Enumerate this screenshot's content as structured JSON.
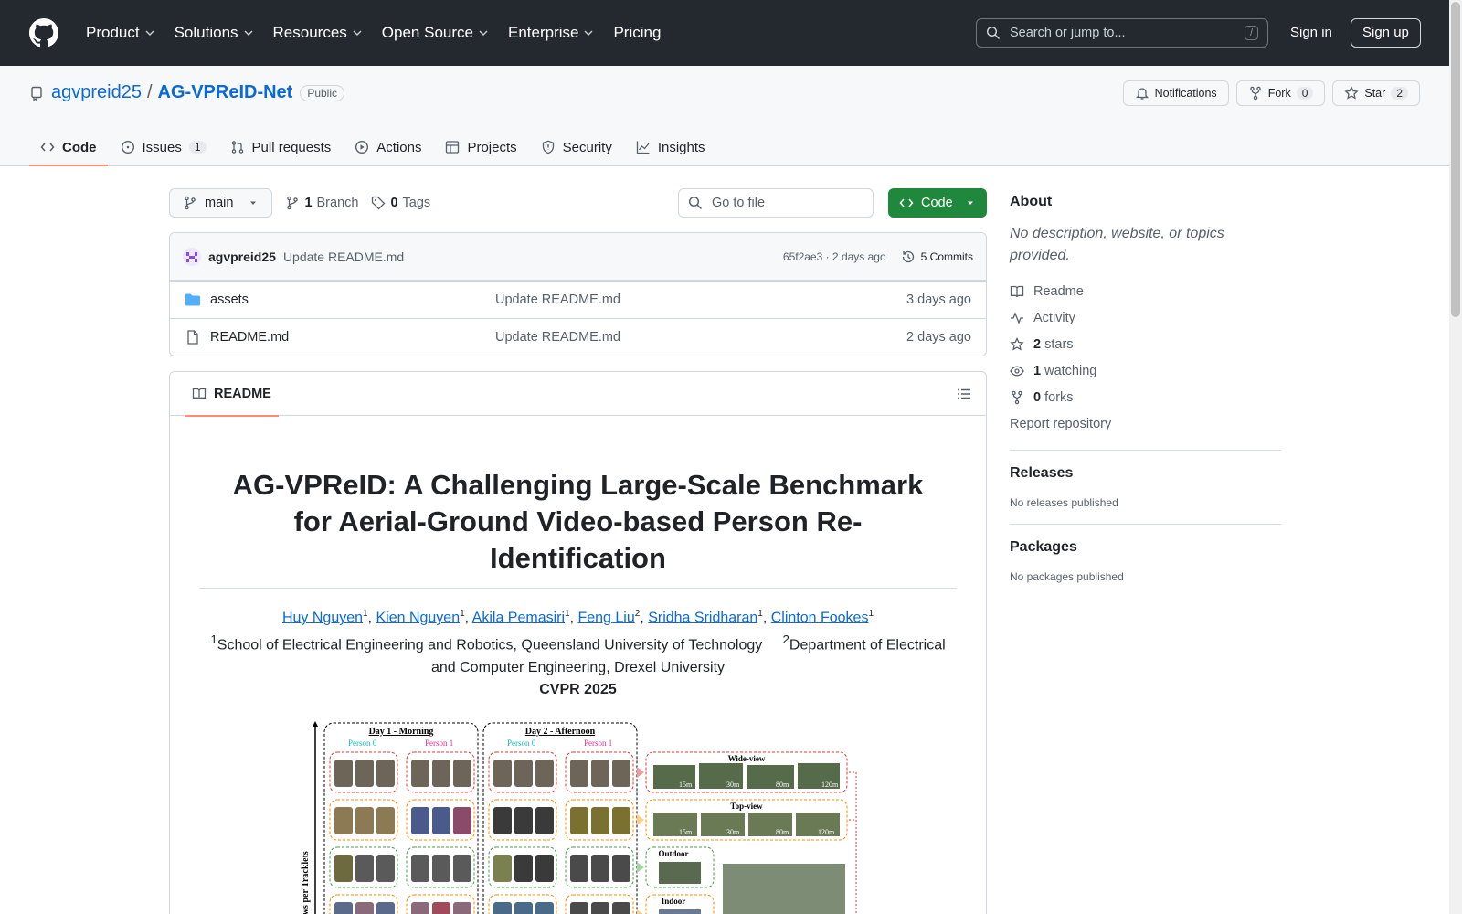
{
  "header": {
    "nav": [
      "Product",
      "Solutions",
      "Resources",
      "Open Source",
      "Enterprise",
      "Pricing"
    ],
    "search_placeholder": "Search or jump to...",
    "search_shortcut": "/",
    "sign_in": "Sign in",
    "sign_up": "Sign up"
  },
  "repo": {
    "owner": "agvpreid25",
    "separator": "/",
    "name": "AG-VPReID-Net",
    "visibility": "Public",
    "notifications_label": "Notifications",
    "fork_label": "Fork",
    "fork_count": "0",
    "star_label": "Star",
    "star_count": "2"
  },
  "tabs": [
    {
      "label": "Code",
      "count": ""
    },
    {
      "label": "Issues",
      "count": "1"
    },
    {
      "label": "Pull requests",
      "count": ""
    },
    {
      "label": "Actions",
      "count": ""
    },
    {
      "label": "Projects",
      "count": ""
    },
    {
      "label": "Security",
      "count": ""
    },
    {
      "label": "Insights",
      "count": ""
    }
  ],
  "filebar": {
    "branch": "main",
    "branch_count": "1",
    "branch_label": "Branch",
    "tag_count": "0",
    "tag_label": "Tags",
    "goto_placeholder": "Go to file",
    "code_button": "Code"
  },
  "latest_commit": {
    "author": "agvpreid25",
    "message": "Update README.md",
    "hash_date": "65f2ae3 · 2 days ago",
    "commits": "5 Commits"
  },
  "files": [
    {
      "name": "assets",
      "type": "folder",
      "message": "Update README.md",
      "date": "3 days ago"
    },
    {
      "name": "README.md",
      "type": "file",
      "message": "Update README.md",
      "date": "2 days ago"
    }
  ],
  "readme": {
    "tab_label": "README",
    "title": "AG-VPReID: A Challenging Large-Scale Benchmark for Aerial-Ground Video-based Person Re-Identification",
    "authors": [
      {
        "name": "Huy Nguyen",
        "sup": "1"
      },
      {
        "name": "Kien Nguyen",
        "sup": "1"
      },
      {
        "name": "Akila Pemasiri",
        "sup": "1"
      },
      {
        "name": "Feng Liu",
        "sup": "2"
      },
      {
        "name": "Sridha Sridharan",
        "sup": "1"
      },
      {
        "name": "Clinton Fookes",
        "sup": "1"
      }
    ],
    "affil_1_sup": "1",
    "affil_1": "School of Electrical Engineering and Robotics, Queensland University of Technology",
    "affil_2_sup": "2",
    "affil_2": "Department of Electrical and Computer Engineering, Drexel University",
    "venue": "CVPR 2025",
    "figure": {
      "day1": "Day 1 - Morning",
      "day2": "Day 2 - Afternoon",
      "person0": "Person 0",
      "person1": "Person 1",
      "wide_view": "Wide-view",
      "top_view": "Top-view",
      "outdoor": "Outdoor",
      "indoor": "Indoor",
      "alt_15": "15m",
      "alt_30": "30m",
      "alt_80": "80m",
      "alt_120": "120m",
      "y_axis": "ra Views per Tracklets"
    }
  },
  "about": {
    "heading": "About",
    "description": "No description, website, or topics provided.",
    "readme": "Readme",
    "activity": "Activity",
    "stars_count": "2",
    "stars_label": "stars",
    "watching_count": "1",
    "watching_label": "watching",
    "forks_count": "0",
    "forks_label": "forks",
    "report": "Report repository"
  },
  "releases": {
    "heading": "Releases",
    "text": "No releases published"
  },
  "packages": {
    "heading": "Packages",
    "text": "No packages published"
  },
  "colors": {
    "header_bg": "#24292f",
    "accent": "#0969da",
    "code_button": "#1f883d",
    "tab_underline": "#fd8c73"
  }
}
